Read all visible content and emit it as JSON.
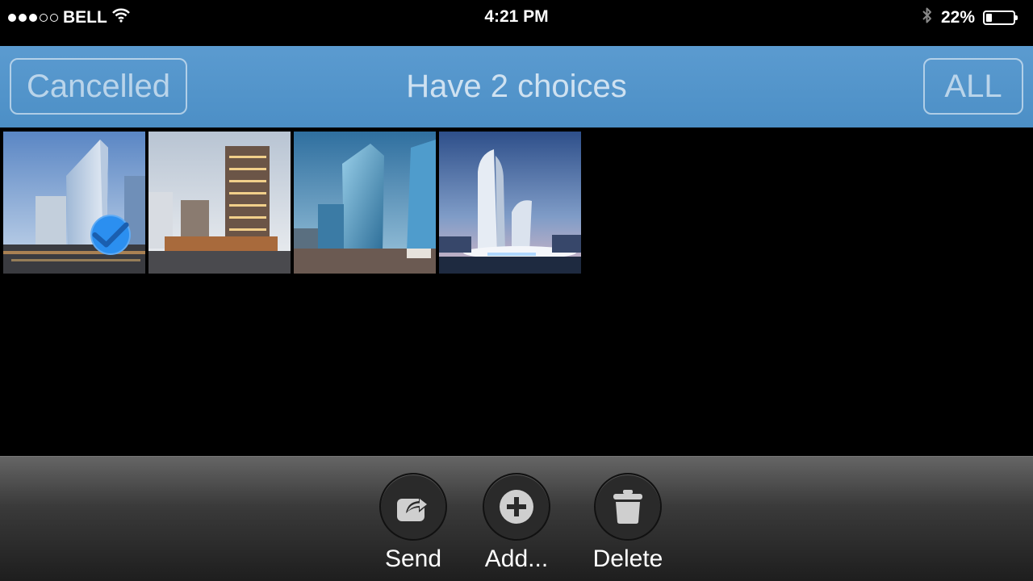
{
  "status_bar": {
    "carrier": "BELL",
    "signal_bars": 3,
    "signal_total": 5,
    "time": "4:21 PM",
    "battery_percent_text": "22%",
    "battery_level": 0.22,
    "icons": [
      "signal-icon",
      "wifi-icon",
      "bluetooth-icon",
      "battery-icon"
    ]
  },
  "nav": {
    "cancel_label": "Cancelled",
    "title": "Have 2 choices",
    "all_label": "ALL",
    "bar_color": "#4c8fc6"
  },
  "photos": [
    {
      "name": "tower-glass-daytime",
      "selected": true
    },
    {
      "name": "tower-residential-dusk",
      "selected": false
    },
    {
      "name": "tower-glass-twin",
      "selected": false
    },
    {
      "name": "tower-curved-night",
      "selected": false
    }
  ],
  "selection_color": "#2b8ff0",
  "toolbar": {
    "send_label": "Send",
    "add_label": "Add...",
    "delete_label": "Delete",
    "icons": [
      "share-icon",
      "plus-circle-icon",
      "trash-icon"
    ]
  }
}
